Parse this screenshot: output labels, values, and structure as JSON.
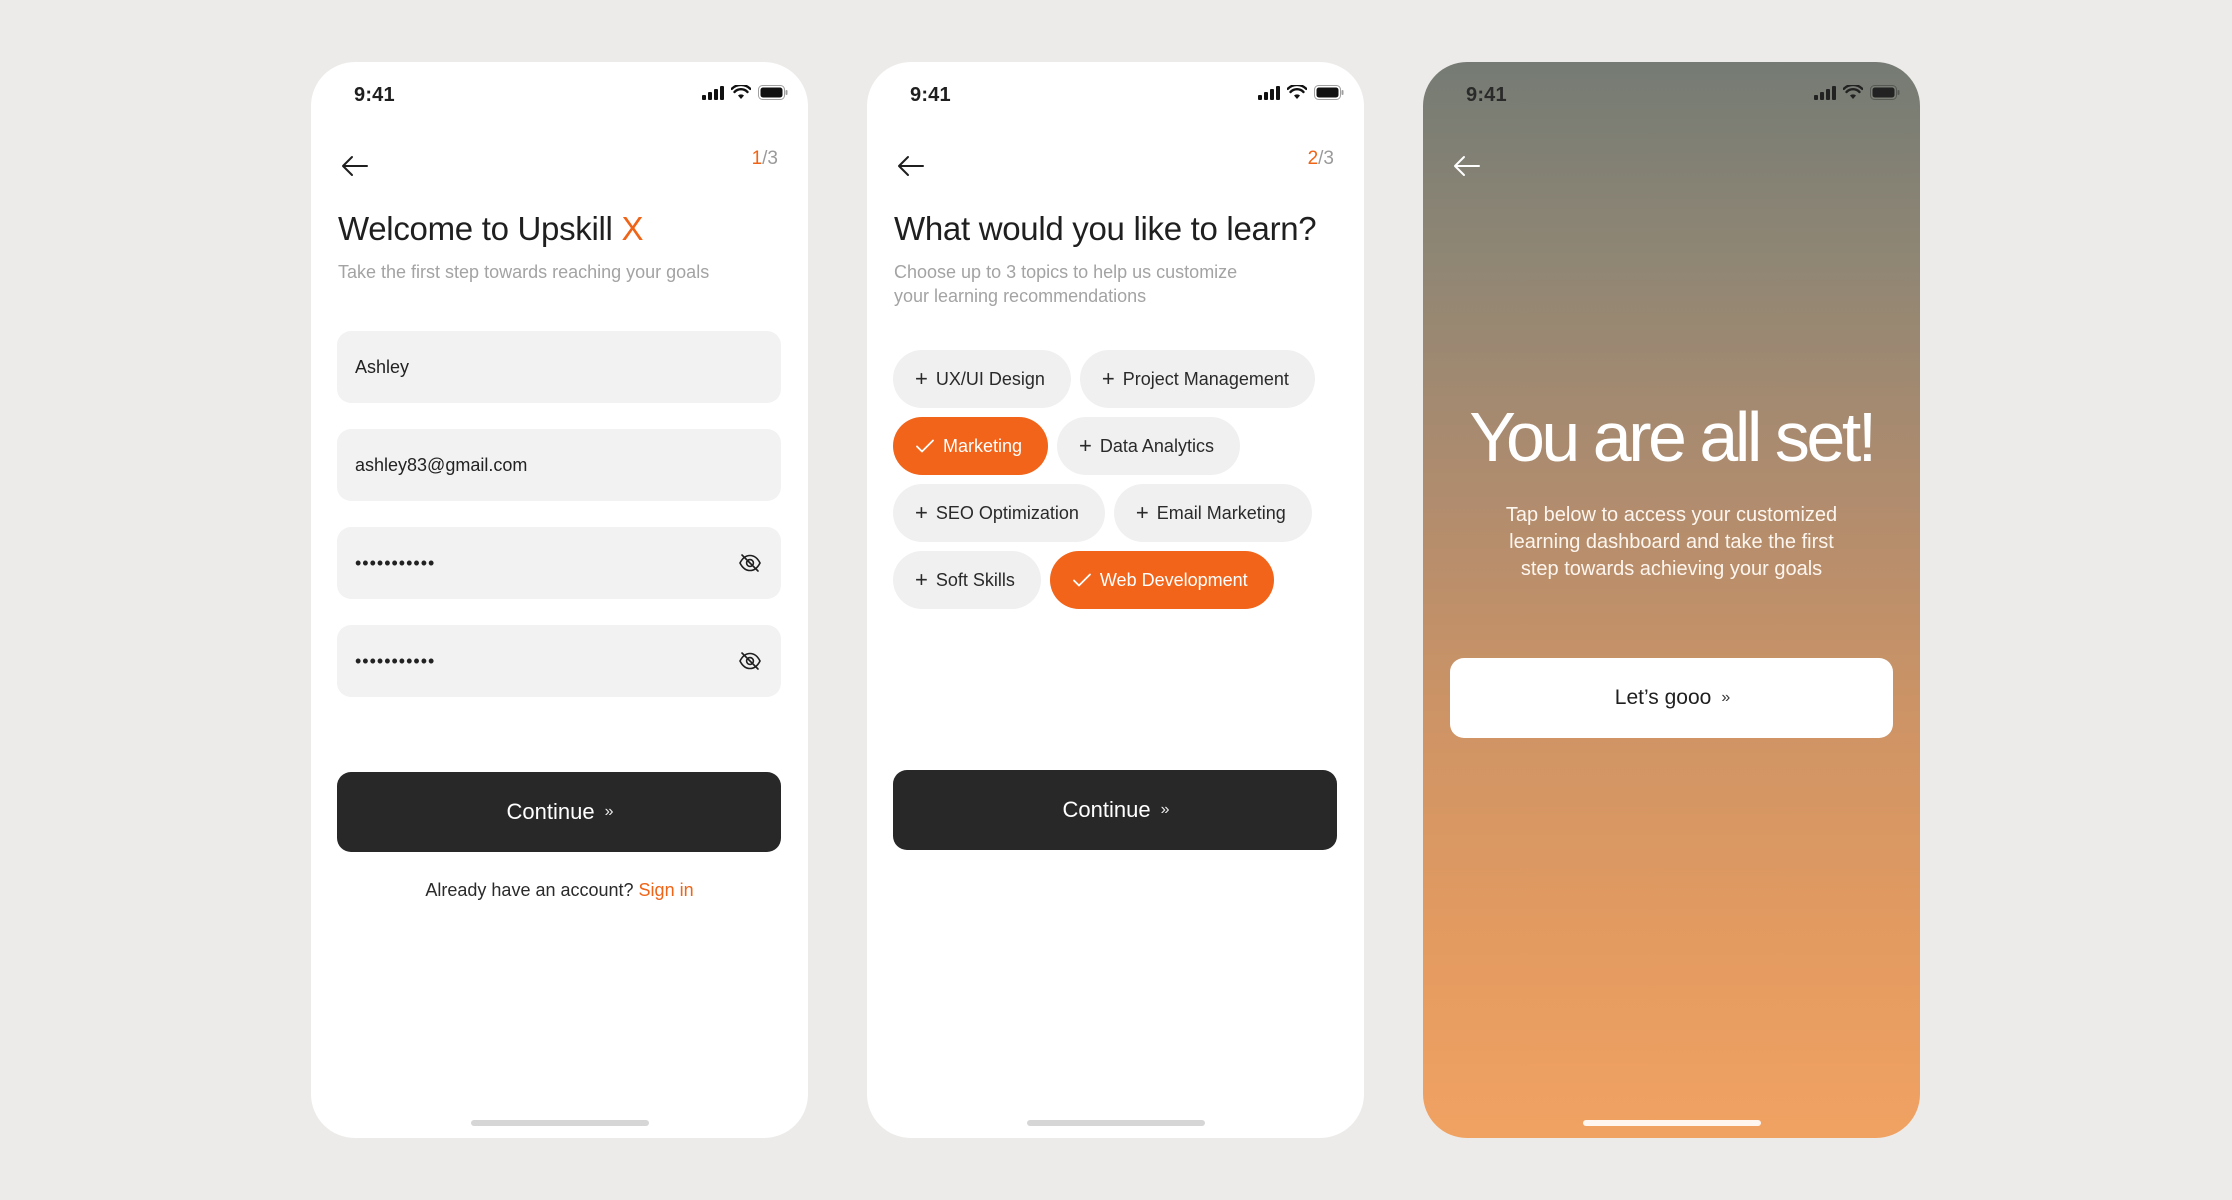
{
  "status_time": "9:41",
  "colors": {
    "accent": "#ef6416",
    "dark_button": "#282828",
    "field_bg": "#f2f2f2"
  },
  "screen1": {
    "step_current": "1",
    "step_total": "/3",
    "title_main": "Welcome to Upskill ",
    "title_accent": "X",
    "subtitle": "Take the first step towards reaching your goals",
    "fields": {
      "name_value": "Ashley",
      "email_value": "ashley83@gmail.com",
      "password_mask": "•••••••••••",
      "confirm_mask": "•••••••••••"
    },
    "continue_label": "Continue",
    "chevron": "»",
    "signin_prompt": "Already have an account? ",
    "signin_link": "Sign in"
  },
  "screen2": {
    "step_current": "2",
    "step_total": "/3",
    "title": "What would you like to learn?",
    "subtitle_line1": "Choose up to 3 topics to help us customize",
    "subtitle_line2": "your learning recommendations",
    "topics": [
      {
        "label": "UX/UI Design",
        "selected": false
      },
      {
        "label": "Project Management",
        "selected": false
      },
      {
        "label": "Marketing",
        "selected": true
      },
      {
        "label": "Data Analytics",
        "selected": false
      },
      {
        "label": "SEO Optimization",
        "selected": false
      },
      {
        "label": "Email Marketing",
        "selected": false
      },
      {
        "label": "Soft Skills",
        "selected": false
      },
      {
        "label": "Web Development",
        "selected": true
      }
    ],
    "continue_label": "Continue",
    "chevron": "»"
  },
  "screen3": {
    "title": "You are all set!",
    "subtitle_line1": "Tap below to access your customized",
    "subtitle_line2": "learning dashboard and take the first",
    "subtitle_line3": "step towards achieving your goals",
    "button_label": "Let’s gooo",
    "chevron": "»"
  }
}
